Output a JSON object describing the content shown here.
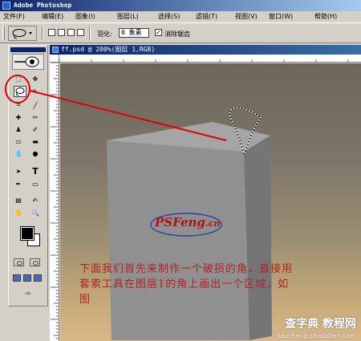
{
  "window": {
    "title": "Adobe Photoshop"
  },
  "menu": [
    "文件(F)",
    "编辑(E)",
    "图象(I)",
    "图层(L)",
    "选择(S)",
    "滤镜(T)",
    "视图(V)",
    "窗口(W)",
    "帮助(H)"
  ],
  "options": {
    "feather_label": "羽化:",
    "feather_value": "0 象素",
    "antialias_label": "消除锯齿"
  },
  "document": {
    "title": "ff.psd @ 200%(图层 1,RGB)"
  },
  "annotation": {
    "line1": "下面我们首先来制作一个破损的角，直接用",
    "line2": "套索工具在图层1的角上画出一个区域，如",
    "line3": "图"
  },
  "logo": {
    "brand": "PSFeng",
    "suffix": ".cn"
  },
  "watermark": {
    "text": "查字典 教程网",
    "url": "jiaocheng.chazidian.com"
  },
  "colors": {
    "accent": "#b22222",
    "titlebar": "#0a246a",
    "highlight_circle": "#e00000"
  },
  "icons": [
    "lasso-icon",
    "move-icon",
    "marquee-icon",
    "brush-icon",
    "stamp-icon",
    "eraser-icon",
    "gradient-icon",
    "pen-icon",
    "type-icon",
    "hand-icon",
    "zoom-icon",
    "eyedropper-icon"
  ]
}
